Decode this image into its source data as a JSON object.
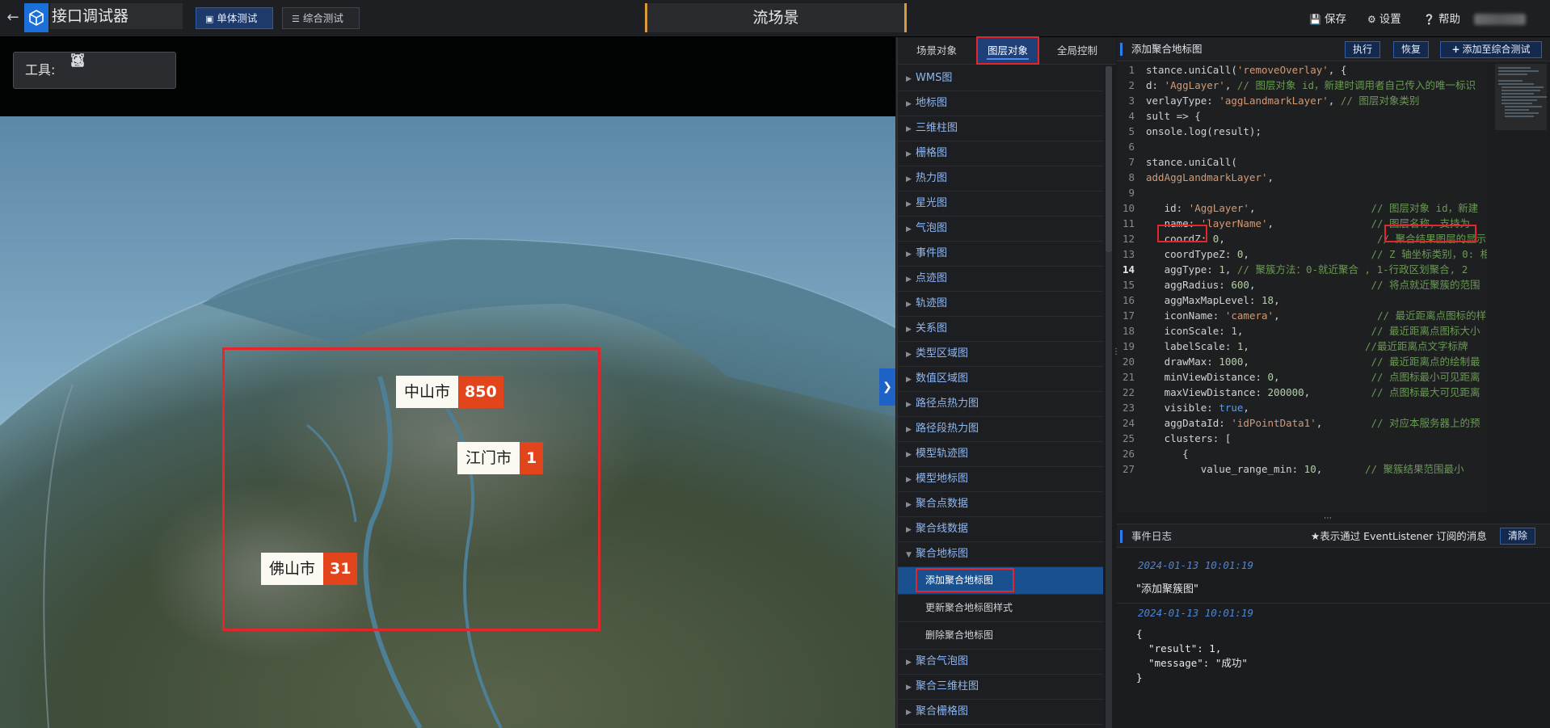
{
  "header": {
    "back_icon": "arrow-left-icon",
    "app_title": "接口调试器",
    "tabs": [
      {
        "label": "单体测试",
        "active": true
      },
      {
        "label": "综合测试",
        "active": false
      }
    ],
    "scene_title": "流场景",
    "actions": {
      "save": "保存",
      "settings": "设置",
      "help": "帮助"
    }
  },
  "map": {
    "toolbox_label": "工具:",
    "tools": [
      "locate-icon",
      "scan-icon",
      "pen-icon",
      "settings-icon"
    ],
    "cities": [
      {
        "name": "中山市",
        "count": "850"
      },
      {
        "name": "江门市",
        "count": "1"
      },
      {
        "name": "佛山市",
        "count": "31"
      }
    ]
  },
  "middle": {
    "tabs": [
      "场景对象",
      "图层对象",
      "全局控制"
    ],
    "active_tab": "图层对象",
    "items": [
      "WMS图",
      "地标图",
      "三维柱图",
      "栅格图",
      "热力图",
      "星光图",
      "气泡图",
      "事件图",
      "点迹图",
      "轨迹图",
      "关系图",
      "类型区域图",
      "数值区域图",
      "路径点热力图",
      "路径段热力图",
      "模型轨迹图",
      "模型地标图",
      "聚合点数据",
      "聚合线数据",
      "聚合地标图"
    ],
    "sub_items": [
      "添加聚合地标图",
      "更新聚合地标图样式",
      "删除聚合地标图"
    ],
    "items_after": [
      "聚合气泡图",
      "聚合三维柱图",
      "聚合栅格图"
    ]
  },
  "right": {
    "title": "添加聚合地标图",
    "buttons": {
      "run": "执行",
      "restore": "恢复",
      "add": "添加至综合测试"
    },
    "code_lines": [
      [
        {
          "t": "k",
          "v": "stance.uniCall("
        },
        {
          "t": "s",
          "v": "'removeOverlay'"
        },
        {
          "t": "k",
          "v": ", {"
        }
      ],
      [
        {
          "t": "k",
          "v": "d: "
        },
        {
          "t": "s",
          "v": "'AggLayer'"
        },
        {
          "t": "k",
          "v": ", "
        },
        {
          "t": "c",
          "v": "// 图层对象 id，新建时调用者自己传入的唯一标识"
        }
      ],
      [
        {
          "t": "k",
          "v": "verlayType: "
        },
        {
          "t": "s",
          "v": "'aggLandmarkLayer'"
        },
        {
          "t": "k",
          "v": ", "
        },
        {
          "t": "c",
          "v": "// 图层对象类别"
        }
      ],
      [
        {
          "t": "k",
          "v": "sult => {"
        }
      ],
      [
        {
          "t": "k",
          "v": "onsole.log(result);"
        }
      ],
      [],
      [
        {
          "t": "k",
          "v": "stance.uniCall("
        }
      ],
      [
        {
          "t": "s",
          "v": "addAggLandmarkLayer'"
        },
        {
          "t": "k",
          "v": ","
        }
      ],
      [],
      [
        {
          "t": "k",
          "v": "   id: "
        },
        {
          "t": "s",
          "v": "'AggLayer'"
        },
        {
          "t": "k",
          "v": ",                   "
        },
        {
          "t": "c",
          "v": "// 图层对象 id，新建"
        }
      ],
      [
        {
          "t": "k",
          "v": "   name: "
        },
        {
          "t": "s",
          "v": "'layerName'"
        },
        {
          "t": "k",
          "v": ",                "
        },
        {
          "t": "c",
          "v": "// 图层名称，支持为"
        }
      ],
      [
        {
          "t": "k",
          "v": "   coordZ: "
        },
        {
          "t": "n",
          "v": "0"
        },
        {
          "t": "k",
          "v": ",                         "
        },
        {
          "t": "c",
          "v": "// 聚合结果图层的显示"
        }
      ],
      [
        {
          "t": "k",
          "v": "   coordTypeZ: "
        },
        {
          "t": "n",
          "v": "0"
        },
        {
          "t": "k",
          "v": ",                    "
        },
        {
          "t": "c",
          "v": "// Z 轴坐标类别，0: 相"
        }
      ],
      [
        {
          "t": "k",
          "v": "   aggType: "
        },
        {
          "t": "n",
          "v": "1"
        },
        {
          "t": "k",
          "v": ", "
        },
        {
          "t": "c",
          "v": "// 聚簇方法：0-就近聚合 , 1-行政区划聚合, 2"
        }
      ],
      [
        {
          "t": "k",
          "v": "   aggRadius: "
        },
        {
          "t": "n",
          "v": "600"
        },
        {
          "t": "k",
          "v": ",                   "
        },
        {
          "t": "c",
          "v": "// 将点就近聚簇的范围"
        }
      ],
      [
        {
          "t": "k",
          "v": "   aggMaxMapLevel: "
        },
        {
          "t": "n",
          "v": "18"
        },
        {
          "t": "k",
          "v": ","
        }
      ],
      [
        {
          "t": "k",
          "v": "   iconName: "
        },
        {
          "t": "s",
          "v": "'camera'"
        },
        {
          "t": "k",
          "v": ",                "
        },
        {
          "t": "c",
          "v": "// 最近距离点图标的样"
        }
      ],
      [
        {
          "t": "k",
          "v": "   iconScale: "
        },
        {
          "t": "n",
          "v": "1"
        },
        {
          "t": "k",
          "v": ",                     "
        },
        {
          "t": "c",
          "v": "// 最近距离点图标大小"
        }
      ],
      [
        {
          "t": "k",
          "v": "   labelScale: "
        },
        {
          "t": "n",
          "v": "1"
        },
        {
          "t": "k",
          "v": ",                   "
        },
        {
          "t": "c",
          "v": "//最近距离点文字标牌"
        }
      ],
      [
        {
          "t": "k",
          "v": "   drawMax: "
        },
        {
          "t": "n",
          "v": "1000"
        },
        {
          "t": "k",
          "v": ",                    "
        },
        {
          "t": "c",
          "v": "// 最近距离点的绘制最"
        }
      ],
      [
        {
          "t": "k",
          "v": "   minViewDistance: "
        },
        {
          "t": "n",
          "v": "0"
        },
        {
          "t": "k",
          "v": ",               "
        },
        {
          "t": "c",
          "v": "// 点图标最小可见距离"
        }
      ],
      [
        {
          "t": "k",
          "v": "   maxViewDistance: "
        },
        {
          "t": "n",
          "v": "200000"
        },
        {
          "t": "k",
          "v": ",          "
        },
        {
          "t": "c",
          "v": "// 点图标最大可见距离"
        }
      ],
      [
        {
          "t": "k",
          "v": "   visible: "
        },
        {
          "t": "kw",
          "v": "true"
        },
        {
          "t": "k",
          "v": ","
        }
      ],
      [
        {
          "t": "k",
          "v": "   aggDataId: "
        },
        {
          "t": "s",
          "v": "'idPointData1'"
        },
        {
          "t": "k",
          "v": ",        "
        },
        {
          "t": "c",
          "v": "// 对应本服务器上的预"
        }
      ],
      [
        {
          "t": "k",
          "v": "   clusters: ["
        }
      ],
      [
        {
          "t": "k",
          "v": "      {"
        }
      ],
      [
        {
          "t": "k",
          "v": "         value_range_min: "
        },
        {
          "t": "n",
          "v": "10"
        },
        {
          "t": "k",
          "v": ",       "
        },
        {
          "t": "c",
          "v": "// 聚簇结果范围最小"
        }
      ]
    ],
    "current_line": 14,
    "event_log": {
      "title": "事件日志",
      "hint": "★表示通过 EventListener 订阅的消息",
      "clear": "清除",
      "entries": [
        {
          "time": "2024-01-13 10:01:19",
          "message": "\"添加聚簇图\""
        },
        {
          "time": "2024-01-13 10:01:19",
          "json": "{\n  \"result\": 1,\n  \"message\": \"成功\"\n}"
        }
      ]
    }
  }
}
